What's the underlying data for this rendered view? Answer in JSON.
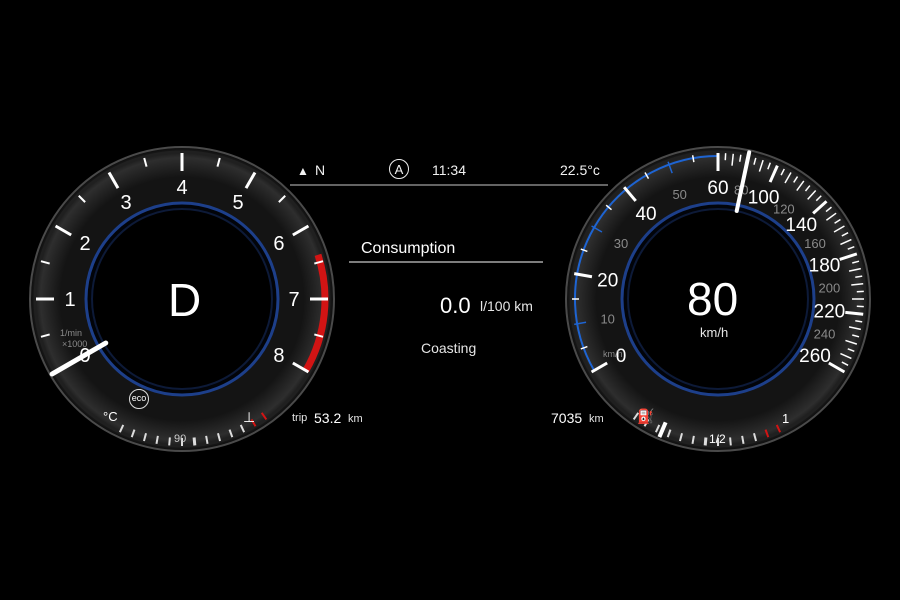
{
  "top_bar": {
    "compass": "N",
    "clock": "11:34",
    "outside_temp": "22.5°c",
    "cruise_icon": "A"
  },
  "tachometer": {
    "gear": "D",
    "unit_line1": "1/min",
    "unit_line2": "×1000",
    "ticks": [
      "0",
      "1",
      "2",
      "3",
      "4",
      "5",
      "6",
      "7",
      "8"
    ],
    "needle_value": 0,
    "redline_start": 6.4,
    "eco_label": "eco",
    "coolant_label": "°C",
    "coolant_mid": "90"
  },
  "center": {
    "title": "Consumption",
    "consumption_value": "0.0",
    "consumption_unit": "l/100 km",
    "status": "Coasting",
    "trip_label": "trip",
    "trip_value": "53.2",
    "trip_unit": "km",
    "odometer_value": "7035",
    "odometer_unit": "km"
  },
  "speedometer": {
    "speed": "80",
    "unit": "km/h",
    "small_unit": "km/h",
    "major_ticks": [
      "0",
      "20",
      "40",
      "60",
      "100",
      "140",
      "180",
      "220",
      "260"
    ],
    "minor_ticks": [
      "10",
      "30",
      "50",
      "80",
      "120",
      "160",
      "200",
      "240"
    ],
    "needle_value": 80,
    "fuel_half": "1/2",
    "fuel_full": "1",
    "fuel_level": 0.8
  },
  "colors": {
    "accent_blue": "#1e64d2",
    "redline": "#d21414",
    "tick_white": "#ffffff",
    "dim_text": "#8a8a8a"
  }
}
